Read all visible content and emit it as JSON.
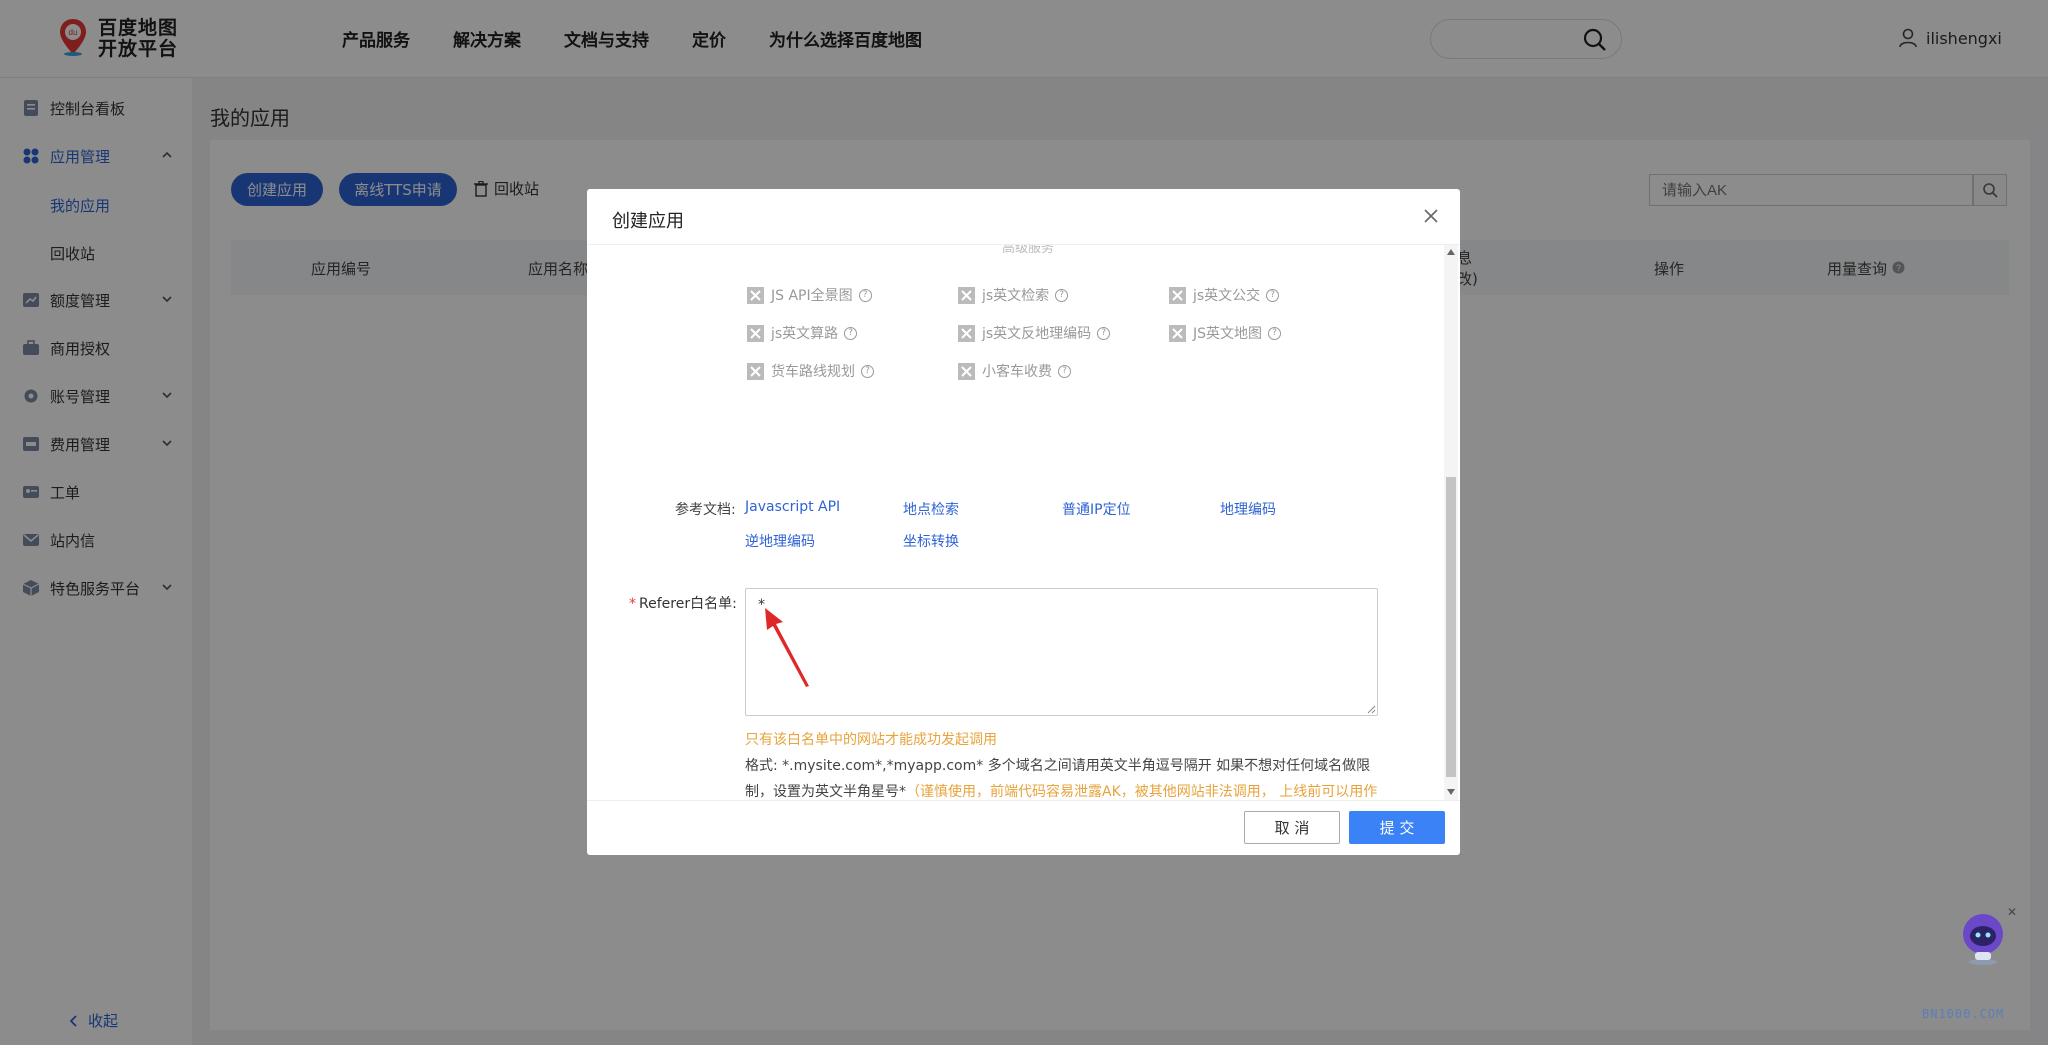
{
  "header": {
    "logo_line1": "百度地图",
    "logo_line2": "开放平台",
    "logo_badge": "du",
    "nav": [
      "产品服务",
      "解决方案",
      "文档与支持",
      "定价",
      "为什么选择百度地图"
    ],
    "username": "ilishengxi"
  },
  "sidebar": {
    "items": [
      {
        "label": "控制台看板",
        "icon": "dashboard-icon"
      },
      {
        "label": "应用管理",
        "icon": "apps-icon",
        "expanded": true
      },
      {
        "label": "额度管理",
        "icon": "quota-icon"
      },
      {
        "label": "商用授权",
        "icon": "briefcase-icon"
      },
      {
        "label": "账号管理",
        "icon": "gear-icon"
      },
      {
        "label": "费用管理",
        "icon": "billing-icon"
      },
      {
        "label": "工单",
        "icon": "ticket-icon"
      },
      {
        "label": "站内信",
        "icon": "mail-icon"
      },
      {
        "label": "特色服务平台",
        "icon": "cube-icon"
      }
    ],
    "sub_items": [
      "我的应用",
      "回收站"
    ],
    "collapse_label": "收起"
  },
  "main": {
    "title": "我的应用",
    "create_btn": "创建应用",
    "tts_btn": "离线TTS申请",
    "recycle_label": "回收站",
    "ak_placeholder": "请输入AK",
    "columns": [
      "应用编号",
      "应用名称",
      "息",
      "改)",
      "操作",
      "用量查询"
    ]
  },
  "modal": {
    "title": "创建应用",
    "section_partial": "高级服务",
    "services": [
      [
        "JS API全景图",
        "js英文检索",
        "js英文公交"
      ],
      [
        "js英文算路",
        "js英文反地理编码",
        "JS英文地图"
      ],
      [
        "货车路线规划",
        "小客车收费"
      ]
    ],
    "ref_label": "参考文档:",
    "ref_links": [
      "Javascript API",
      "地点检索",
      "普通IP定位",
      "地理编码",
      "逆地理编码",
      "坐标转换"
    ],
    "referer_label": "Referer白名单:",
    "referer_value": "*",
    "hint": "只有该白名单中的网站才能成功发起调用",
    "format_text": "格式: *.mysite.com*,*myapp.com* 多个域名之间请用英文半角逗号隔开 如果不想对任何域名做限制，设置为英文半角星号*",
    "format_warning": "（谨慎使用，前端代码容易泄露AK，被其他网站非法调用， 上线前可以用作Debug，线上正式ak请设置合理的Referer白名单）",
    "cancel": "取 消",
    "submit": "提 交"
  },
  "watermark": "BN1000.COM",
  "colors": {
    "primary": "#2f63d4",
    "submit": "#3b82f6",
    "warning": "#e8a33a",
    "required": "#e04040"
  }
}
